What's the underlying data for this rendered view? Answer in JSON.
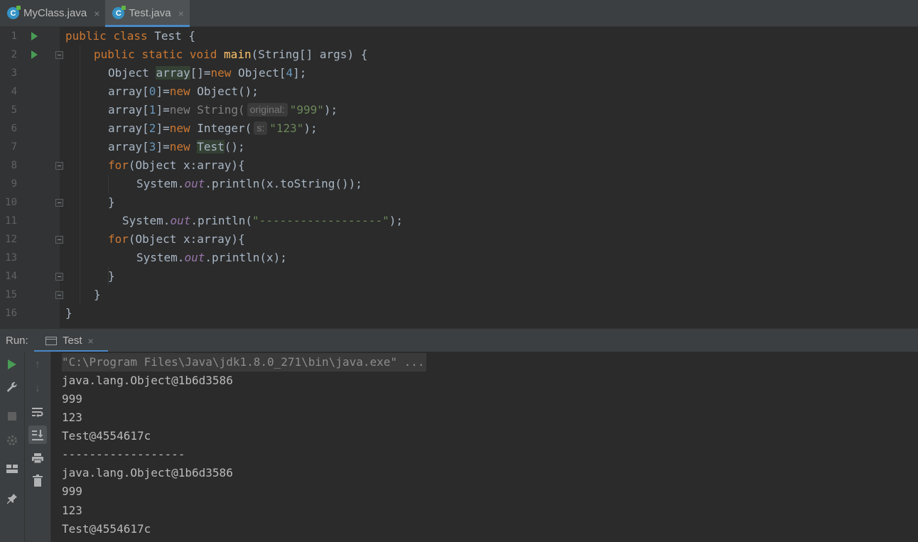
{
  "tabs": [
    {
      "label": "MyClass.java",
      "icon": "java-class-icon",
      "active": false
    },
    {
      "label": "Test.java",
      "icon": "java-class-icon",
      "active": true
    }
  ],
  "tab_close_glyph": "×",
  "line_numbers": [
    "1",
    "2",
    "3",
    "4",
    "5",
    "6",
    "7",
    "8",
    "9",
    "10",
    "11",
    "12",
    "13",
    "14",
    "15",
    "16"
  ],
  "code": {
    "l1": {
      "kw1": "public",
      "kw2": "class",
      "name": "Test",
      "brace": "{"
    },
    "l2": {
      "kw1": "public",
      "kw2": "static",
      "kw3": "void",
      "fn": "main",
      "rest": "(String[] args) {"
    },
    "l3": {
      "t1": "Object ",
      "hl": "array",
      "t2": "[]=",
      "kw": "new",
      "t3": " Object[",
      "num": "4",
      "t4": "];"
    },
    "l4": {
      "t1": "array[",
      "num": "0",
      "t2": "]=",
      "kw": "new",
      "t3": " Object();"
    },
    "l5": {
      "t1": "array[",
      "num": "1",
      "t2": "]=",
      "kw": "new",
      "t3": " String(",
      "hint": "original:",
      "str": "\"999\"",
      "t4": ");"
    },
    "l6": {
      "t1": "array[",
      "num": "2",
      "t2": "]=",
      "kw": "new",
      "t3": " Integer(",
      "hint": "s:",
      "str": "\"123\"",
      "t4": ");"
    },
    "l7": {
      "t1": "array[",
      "num": "3",
      "t2": "]=",
      "kw": "new",
      "t3": " ",
      "hl": "Test",
      "t4": "();"
    },
    "l8": {
      "kw": "for",
      "t1": "(Object x:array){"
    },
    "l9": {
      "t1": "System.",
      "field": "out",
      "t2": ".println(x.toString());"
    },
    "l10": {
      "t1": "}"
    },
    "l11": {
      "t1": "System.",
      "field": "out",
      "t2": ".println(",
      "str": "\"------------------\"",
      "t3": ");"
    },
    "l12": {
      "kw": "for",
      "t1": "(Object x:array){"
    },
    "l13": {
      "t1": "System.",
      "field": "out",
      "t2": ".println(x);"
    },
    "l14": {
      "t1": "}"
    },
    "l15": {
      "t1": "}"
    },
    "l16": {
      "t1": "}"
    }
  },
  "run_panel": {
    "label": "Run:",
    "tab_label": "Test",
    "output": [
      "\"C:\\Program Files\\Java\\jdk1.8.0_271\\bin\\java.exe\" ...",
      "java.lang.Object@1b6d3586",
      "999",
      "123",
      "Test@4554617c",
      "------------------",
      "java.lang.Object@1b6d3586",
      "999",
      "123",
      "Test@4554617c"
    ]
  },
  "colors": {
    "keyword": "#cc7832",
    "function": "#ffc66d",
    "number": "#6897bb",
    "string": "#6a8759",
    "field": "#9876aa",
    "accent": "#4a88c7"
  }
}
